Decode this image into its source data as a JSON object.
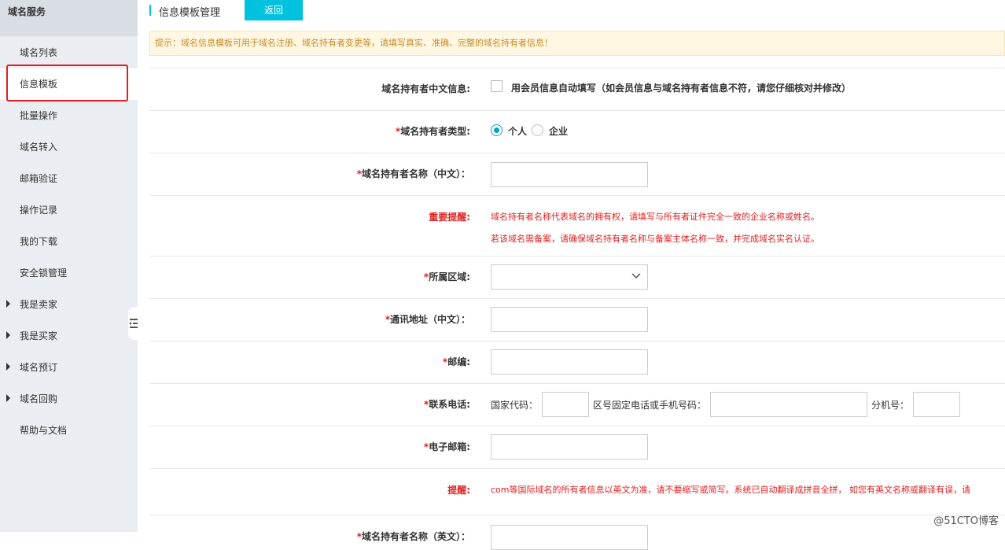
{
  "sidebar": {
    "header": "域名服务",
    "items": [
      {
        "label": "域名列表",
        "caret": false
      },
      {
        "label": "信息模板",
        "caret": false,
        "active": true
      },
      {
        "label": "批量操作",
        "caret": false
      },
      {
        "label": "域名转入",
        "caret": false
      },
      {
        "label": "邮箱验证",
        "caret": false
      },
      {
        "label": "操作记录",
        "caret": false
      },
      {
        "label": "我的下载",
        "caret": false
      },
      {
        "label": "安全锁管理",
        "caret": false
      },
      {
        "label": "我是卖家",
        "caret": true
      },
      {
        "label": "我是买家",
        "caret": true
      },
      {
        "label": "域名预订",
        "caret": true
      },
      {
        "label": "域名回购",
        "caret": true
      },
      {
        "label": "帮助与文档",
        "caret": false
      }
    ]
  },
  "header": {
    "title": "信息模板管理",
    "back_label": "返回"
  },
  "tip": "提示：域名信息模板可用于域名注册、域名持有者变更等，请填写真实、准确、完整的域名持有者信息！",
  "form": {
    "cn_info_label": "域名持有者中文信息:",
    "autofill_label": "用会员信息自动填写（如会员信息与域名持有者信息不符，请您仔细核对并修改）",
    "req_mark": "*",
    "type_label": "域名持有者类型:",
    "type_personal": "个人",
    "type_company": "企业",
    "name_cn_label": "域名持有者名称（中文）：",
    "important_label": "重要提醒:",
    "important_line1": "域名持有者名称代表域名的拥有权，请填写与所有者证件完全一致的企业名称或姓名。",
    "important_line2": "若该域名需备案，请确保域名持有者名称与备案主体名称一致，并完成域名实名认证。",
    "region_label": "所属区域:",
    "address_label": "通讯地址（中文）：",
    "zip_label": "邮编:",
    "phone_label": "联系电话:",
    "country_code_label": "国家代码：",
    "phone_number_label": "区号固定电话或手机号码：",
    "ext_label": "分机号：",
    "email_label": "电子邮箱:",
    "remind_label": "提醒:",
    "remind_text": "com等国际域名的所有者信息以英文为准，请不要缩写或简写。系统已自动翻译成拼音全拼， 如您有英文名称或翻译有误，请",
    "name_en_label": "域名持有者名称（英文）："
  },
  "watermark": "@51CTO博客",
  "colors": {
    "accent": "#00c1de",
    "warning": "#e02020",
    "tip_bg": "#fff7e1"
  }
}
